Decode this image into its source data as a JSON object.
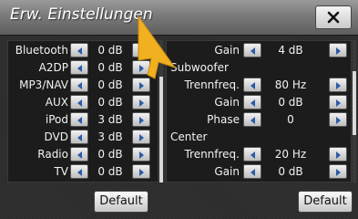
{
  "window": {
    "title": "Erw. Einstellungen"
  },
  "close_icon": "close-x-icon",
  "left_panel": {
    "rows": [
      {
        "label": "Bluetooth",
        "value": "0 dB"
      },
      {
        "label": "A2DP",
        "value": "0 dB"
      },
      {
        "label": "MP3/NAV",
        "value": "0 dB"
      },
      {
        "label": "AUX",
        "value": "0 dB"
      },
      {
        "label": "iPod",
        "value": "3 dB"
      },
      {
        "label": "DVD",
        "value": "3 dB"
      },
      {
        "label": "Radio",
        "value": "0 dB"
      },
      {
        "label": "TV",
        "value": "0 dB"
      }
    ],
    "default_label": "Default"
  },
  "right_panel": {
    "gain_top": {
      "label": "Gain",
      "value": "4 dB"
    },
    "subwoofer": {
      "header": "Subwoofer",
      "trennfreq": {
        "label": "Trennfreq.",
        "value": "80 Hz"
      },
      "gain": {
        "label": "Gain",
        "value": "0 dB"
      },
      "phase": {
        "label": "Phase",
        "value": "0"
      }
    },
    "center": {
      "header": "Center",
      "trennfreq": {
        "label": "Trennfreq.",
        "value": "20 Hz"
      },
      "gain": {
        "label": "Gain",
        "value": "0 dB"
      }
    },
    "default_label": "Default"
  },
  "colors": {
    "accent_arrow": "#2a5aa8",
    "pointer": "#f0b020"
  }
}
